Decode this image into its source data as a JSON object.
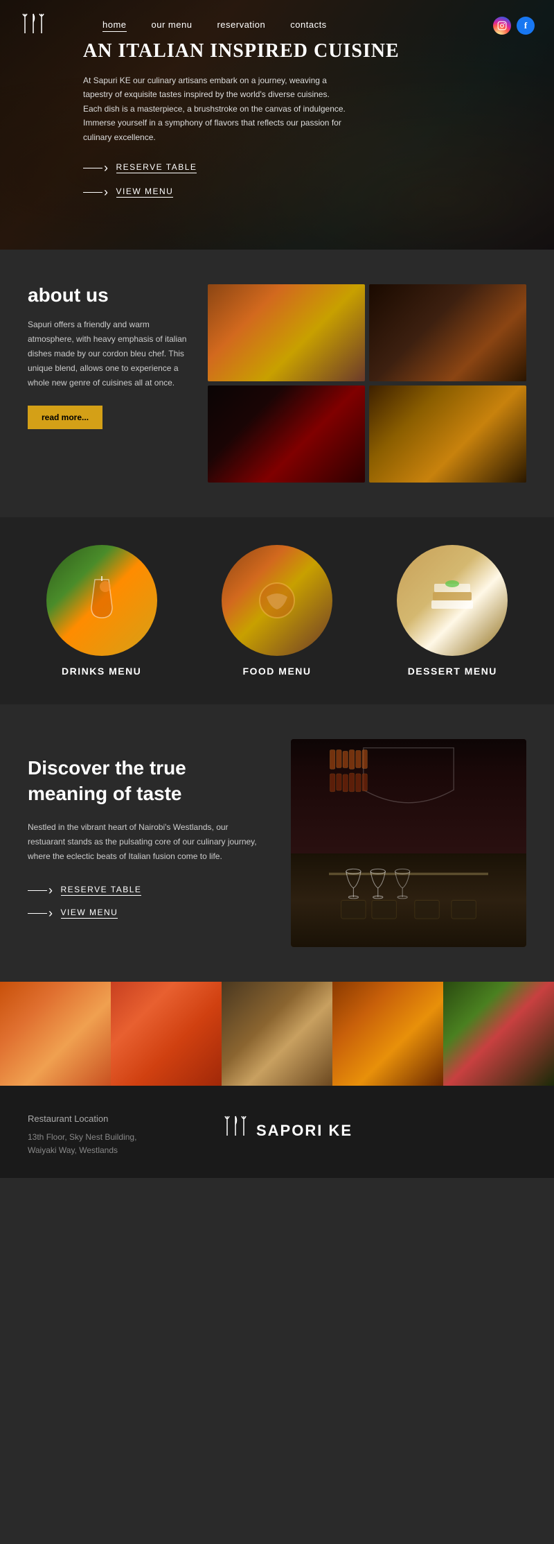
{
  "nav": {
    "links": [
      {
        "label": "home",
        "active": true
      },
      {
        "label": "our menu",
        "active": false
      },
      {
        "label": "reservation",
        "active": false
      },
      {
        "label": "contacts",
        "active": false
      }
    ]
  },
  "hero": {
    "title": "AN ITALIAN INSPIRED CUISINE",
    "description": "At Sapuri KE our culinary artisans embark on a journey, weaving a tapestry of exquisite tastes inspired by the world's diverse cuisines. Each dish is a masterpiece, a brushstroke on the canvas of indulgence. Immerse yourself in a symphony of flavors that reflects our passion for culinary excellence.",
    "btn_reserve": "RESERVE TABLE",
    "btn_menu": "VIEW MENU"
  },
  "about": {
    "title": "about us",
    "text": "Sapuri offers a friendly and warm atmosphere, with heavy emphasis of italian dishes made by our cordon bleu chef. This unique blend, allows one to experience a whole new genre of cuisines all at once.",
    "btn_label": "read more..."
  },
  "menu": {
    "items": [
      {
        "label": "DRINKS MENU"
      },
      {
        "label": "FOOD MENU"
      },
      {
        "label": "DESSERT MENU"
      }
    ]
  },
  "discover": {
    "title": "Discover the true meaning of taste",
    "text": "Nestled in the vibrant heart of Nairobi's Westlands, our restuarant stands as the pulsating core of our culinary journey, where the eclectic beats of Italian fusion come to life.",
    "btn_reserve": "RESERVE TABLE",
    "btn_menu": "VIEW MENU"
  },
  "footer": {
    "location_label": "Restaurant Location",
    "address": "13th Floor, Sky Nest Building,\nWaiyaki Way, Westlands",
    "logo_text": "SAPORI KE"
  }
}
